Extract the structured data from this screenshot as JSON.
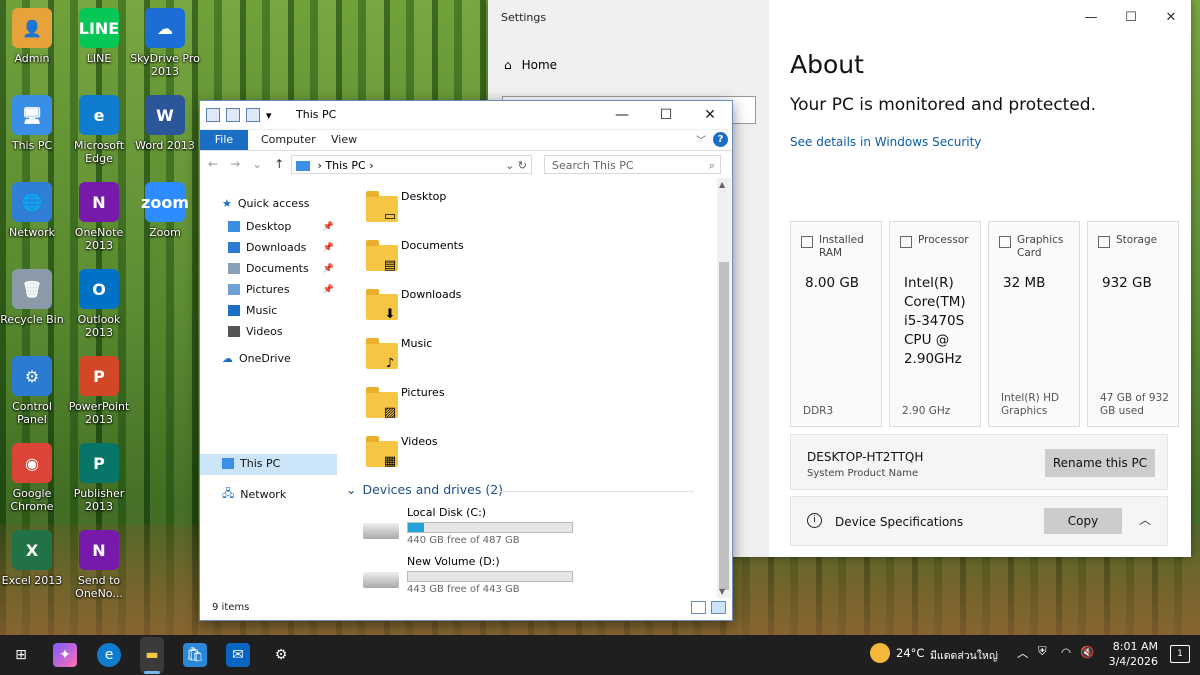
{
  "desktop": {
    "icons": [
      {
        "label": "Admin",
        "color": "#e8a23c",
        "glyph": "👤"
      },
      {
        "label": "LINE",
        "color": "#06c755",
        "glyph": "LINE"
      },
      {
        "label": "SkyDrive Pro 2013",
        "color": "#1c6ed6",
        "glyph": "☁"
      },
      {
        "label": "This PC",
        "color": "#3a8ee6",
        "glyph": "🖥"
      },
      {
        "label": "Microsoft Edge",
        "color": "#0f7ccf",
        "glyph": "e"
      },
      {
        "label": "Word 2013",
        "color": "#2b579a",
        "glyph": "W"
      },
      {
        "label": "Network",
        "color": "#2f7fd6",
        "glyph": "🌐"
      },
      {
        "label": "OneNote 2013",
        "color": "#7719aa",
        "glyph": "N"
      },
      {
        "label": "Zoom",
        "color": "#2d8cff",
        "glyph": "zoom"
      },
      {
        "label": "Recycle Bin",
        "color": "#8a9aa8",
        "glyph": "🗑"
      },
      {
        "label": "Outlook 2013",
        "color": "#0072c6",
        "glyph": "O"
      },
      {
        "label": "Control Panel",
        "color": "#2a7bd1",
        "glyph": "⚙"
      },
      {
        "label": "PowerPoint 2013",
        "color": "#d24726",
        "glyph": "P"
      },
      {
        "label": "Google Chrome",
        "color": "#db4437",
        "glyph": "◉"
      },
      {
        "label": "Publisher 2013",
        "color": "#077568",
        "glyph": "P"
      },
      {
        "label": "Excel 2013",
        "color": "#217346",
        "glyph": "X"
      },
      {
        "label": "Send to OneNo...",
        "color": "#7719aa",
        "glyph": "N"
      }
    ]
  },
  "settings": {
    "title": "Settings",
    "home": "Home",
    "about_heading": "About",
    "protected": "Your PC is monitored and protected.",
    "security_link": "See details in Windows Security",
    "cards": [
      {
        "label": "Installed RAM",
        "value": "8.00 GB",
        "foot": "DDR3"
      },
      {
        "label": "Processor",
        "value": "Intel(R) Core(TM) i5-3470S CPU @ 2.90GHz",
        "foot": "2.90 GHz"
      },
      {
        "label": "Graphics Card",
        "value": "32 MB",
        "foot": "Intel(R) HD Graphics"
      },
      {
        "label": "Storage",
        "value": "932 GB",
        "foot": "47 GB of 932 GB used"
      }
    ],
    "pc_name": "DESKTOP-HT2TTQH",
    "pc_sub": "System Product Name",
    "rename_label": "Rename this PC",
    "device_specs": "Device Specifications",
    "copy_label": "Copy"
  },
  "explorer": {
    "title": "This PC",
    "ribbon": {
      "file": "File",
      "computer": "Computer",
      "view": "View",
      "help": "?"
    },
    "address": "This PC",
    "search_placeholder": "Search This PC",
    "nav": {
      "quick_access": "Quick access",
      "items": [
        "Desktop",
        "Downloads",
        "Documents",
        "Pictures",
        "Music",
        "Videos"
      ],
      "onedrive": "OneDrive",
      "thispc": "This PC",
      "network": "Network"
    },
    "folders": [
      {
        "name": "Desktop",
        "badge": "▭"
      },
      {
        "name": "Documents",
        "badge": "▤"
      },
      {
        "name": "Downloads",
        "badge": "⬇"
      },
      {
        "name": "Music",
        "badge": "♪"
      },
      {
        "name": "Pictures",
        "badge": "▨"
      },
      {
        "name": "Videos",
        "badge": "▦"
      }
    ],
    "devices_heading": "Devices and drives (2)",
    "drives": [
      {
        "name": "Local Disk (C:)",
        "free": "440 GB free of 487 GB",
        "used_fraction": 0.097
      },
      {
        "name": "New Volume (D:)",
        "free": "443 GB free of 443 GB",
        "used_fraction": 0.0
      }
    ],
    "item_count": "9 items"
  },
  "taskbar": {
    "weather": "24°C",
    "weather_text": "มีแดดส่วนใหญ่",
    "time": "8:01 AM",
    "date": "3/4/2026",
    "notifications": "1"
  }
}
